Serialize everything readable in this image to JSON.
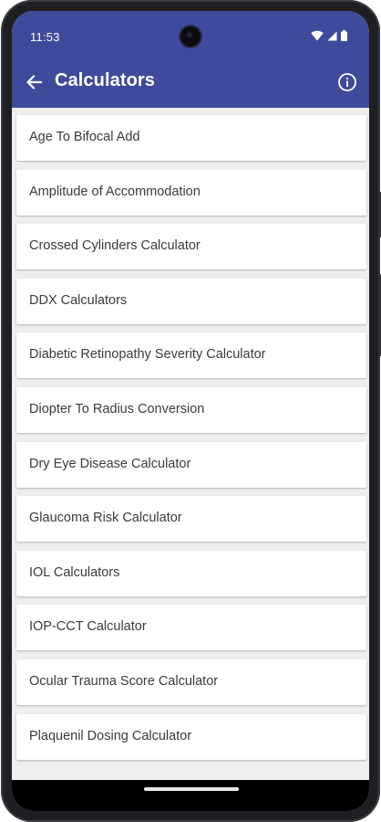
{
  "status_bar": {
    "time": "11:53"
  },
  "app_bar": {
    "title": "Calculators",
    "background": "#3f4b9a",
    "back_icon": "arrow-left-icon",
    "info_icon": "info-circle-icon"
  },
  "list": {
    "items": [
      {
        "label": "Age To Bifocal Add"
      },
      {
        "label": "Amplitude of Accommodation"
      },
      {
        "label": "Crossed Cylinders Calculator"
      },
      {
        "label": "DDX Calculators"
      },
      {
        "label": "Diabetic Retinopathy Severity Calculator"
      },
      {
        "label": "Diopter To Radius Conversion"
      },
      {
        "label": "Dry Eye Disease Calculator"
      },
      {
        "label": "Glaucoma Risk Calculator"
      },
      {
        "label": "IOL Calculators"
      },
      {
        "label": "IOP-CCT Calculator"
      },
      {
        "label": "Ocular Trauma Score Calculator"
      },
      {
        "label": "Plaquenil Dosing Calculator"
      }
    ]
  }
}
